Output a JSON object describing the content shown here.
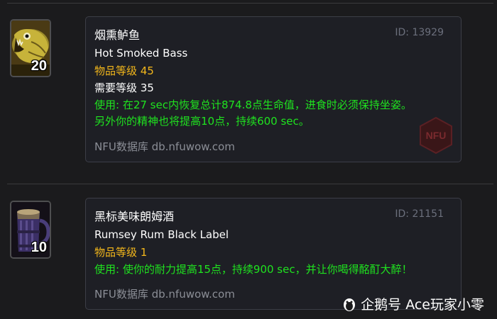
{
  "items": [
    {
      "stack_count": "20",
      "name_cn": "烟熏鲈鱼",
      "name_en": "Hot Smoked Bass",
      "id_text": "ID: 13929",
      "item_level": "物品等级 45",
      "required_level": "需要等级 35",
      "use_line1": "使用: 在27 sec内恢复总计874.8点生命值，进食时必须保持坐姿。",
      "use_line2": "另外你的精神也将提高10点，持续600 sec。",
      "source": "NFU数据库 db.nfuwow.com",
      "icon": "fish-icon"
    },
    {
      "stack_count": "10",
      "name_cn": "黑标美味朗姆酒",
      "name_en": "Rumsey Rum Black Label",
      "id_text": "ID: 21151",
      "item_level": "物品等级 1",
      "use_line1": "使用: 使你的耐力提高15点，持续900 sec，并让你喝得酩酊大醉！",
      "source": "NFU数据库 db.nfuwow.com",
      "icon": "mug-icon"
    }
  ],
  "badge_text": "NFU",
  "watermark": "企鹅号 Ace玩家小零",
  "colors": {
    "item_level": "#f3b71b",
    "use_text": "#1fe31f",
    "id_text": "#6b6f7c",
    "source_text": "#8b8e96"
  }
}
